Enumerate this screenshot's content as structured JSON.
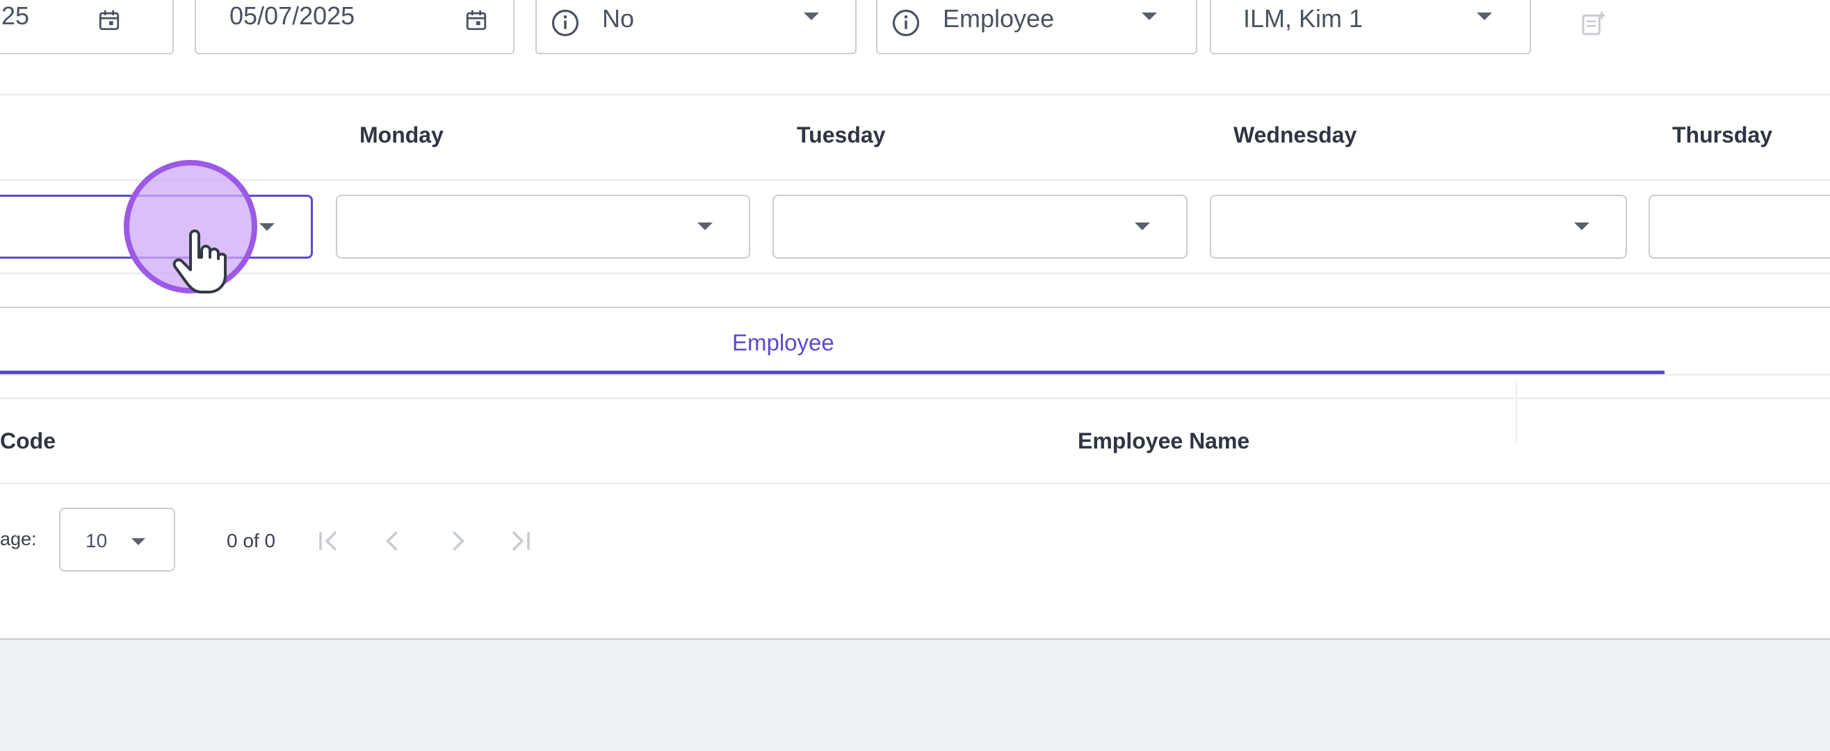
{
  "filters": {
    "start_date": "25",
    "end_date": "05/07/2025",
    "yes_no_value": "No",
    "role_value": "Employee",
    "person_value": "ILM, Kim 1"
  },
  "schedule": {
    "day_headers": [
      "Monday",
      "Tuesday",
      "Wednesday",
      "Thursday"
    ]
  },
  "tabs": {
    "active": "Employee"
  },
  "table": {
    "columns": [
      "Code",
      "Employee Name"
    ]
  },
  "pagination": {
    "rows_per_page_label": "age:",
    "rows_per_page_value": "10",
    "range_text": "0 of 0"
  },
  "colors": {
    "accent": "#5b4bc9",
    "cursor_highlight": "#9b59e6"
  }
}
